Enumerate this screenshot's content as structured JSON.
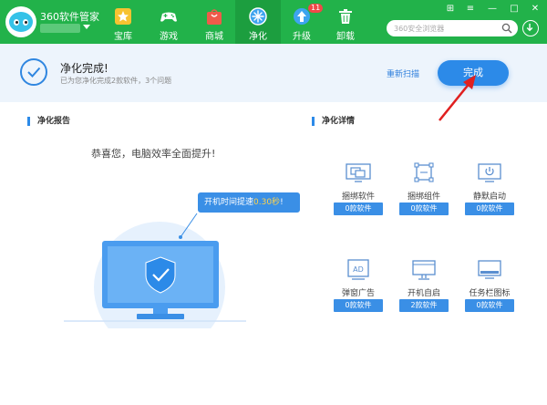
{
  "header": {
    "app_title": "360软件管家",
    "nav": [
      {
        "label": "宝库",
        "icon": "star-icon"
      },
      {
        "label": "游戏",
        "icon": "gamepad-icon"
      },
      {
        "label": "商城",
        "icon": "shopping-bag-icon"
      },
      {
        "label": "净化",
        "icon": "purify-icon",
        "active": true
      },
      {
        "label": "升级",
        "icon": "upgrade-arrow-icon",
        "badge": "11"
      },
      {
        "label": "卸载",
        "icon": "trash-icon"
      }
    ],
    "search_placeholder": "360安全浏览器"
  },
  "status": {
    "title": "净化完成!",
    "subtitle": "已为您净化完成2款软件，3个问题",
    "rescan_label": "重新扫描",
    "done_label": "完成"
  },
  "report": {
    "header": "净化报告",
    "congrats": "恭喜您，电脑效率全面提升!",
    "speedup_prefix": "开机时间提速",
    "speedup_value": "0.30秒",
    "speedup_suffix": "!"
  },
  "details": {
    "header": "净化详情",
    "items": [
      {
        "label": "捆绑软件",
        "count": "0款软件",
        "icon": "bundled-software-icon"
      },
      {
        "label": "捆绑组件",
        "count": "0款软件",
        "icon": "bundled-component-icon"
      },
      {
        "label": "静默启动",
        "count": "0款软件",
        "icon": "silent-startup-icon"
      },
      {
        "label": "弹窗广告",
        "count": "0款软件",
        "icon": "popup-ad-icon"
      },
      {
        "label": "开机自启",
        "count": "2款软件",
        "icon": "auto-start-icon"
      },
      {
        "label": "任务栏图标",
        "count": "0款软件",
        "icon": "taskbar-icon"
      }
    ]
  },
  "colors": {
    "brand_green": "#22b24a",
    "accent_blue": "#2c8ae8",
    "annotation_red": "#e02020"
  }
}
